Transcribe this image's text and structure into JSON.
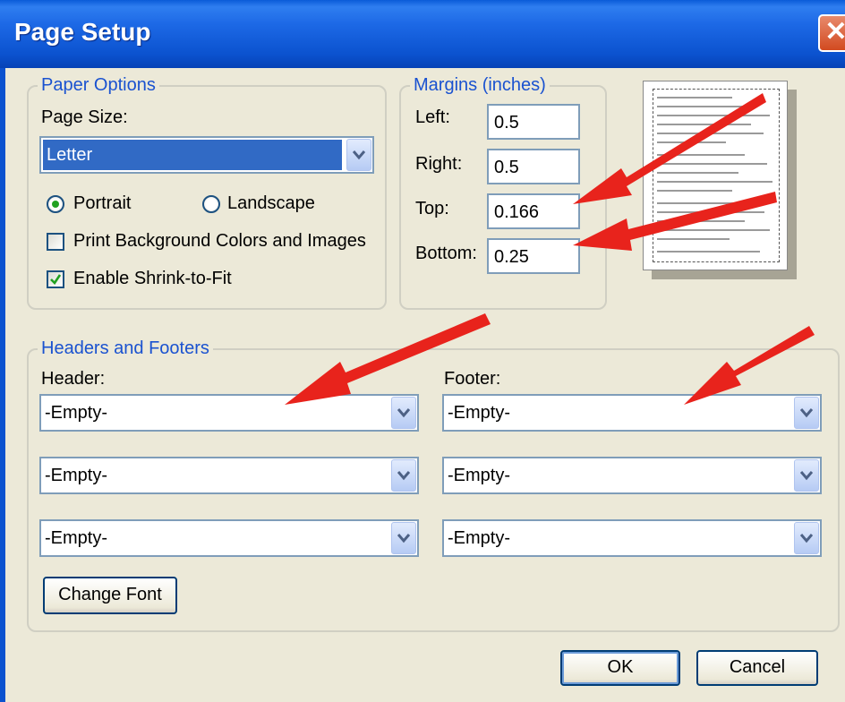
{
  "window": {
    "title": "Page Setup",
    "close_label": "✕"
  },
  "paper_options": {
    "legend": "Paper Options",
    "page_size_label": "Page Size:",
    "page_size_value": "Letter",
    "portrait_label": "Portrait",
    "landscape_label": "Landscape",
    "orientation_selected": "Portrait",
    "print_background_label": "Print Background Colors and Images",
    "print_background_checked": false,
    "shrink_to_fit_label": "Enable Shrink-to-Fit",
    "shrink_to_fit_checked": true
  },
  "margins": {
    "legend": "Margins (inches)",
    "left_label": "Left:",
    "left_value": "0.5",
    "right_label": "Right:",
    "right_value": "0.5",
    "top_label": "Top:",
    "top_value": "0.166",
    "bottom_label": "Bottom:",
    "bottom_value": "0.25"
  },
  "headers_footers": {
    "legend": "Headers and Footers",
    "header_label": "Header:",
    "footer_label": "Footer:",
    "header_values": [
      "-Empty-",
      "-Empty-",
      "-Empty-"
    ],
    "footer_values": [
      "-Empty-",
      "-Empty-",
      "-Empty-"
    ],
    "change_font_label": "Change Font"
  },
  "buttons": {
    "ok_label": "OK",
    "cancel_label": "Cancel"
  },
  "icons": {
    "dropdown": "chevron-down-icon",
    "checkmark": "checkmark-icon",
    "annotation": "red-arrow-icon"
  },
  "colors": {
    "titlebar": "#0b52cf",
    "dialog_bg": "#ece9d8",
    "legend_text": "#1a52d0",
    "selection": "#316ac5",
    "annotation_arrow": "#e8231c"
  }
}
